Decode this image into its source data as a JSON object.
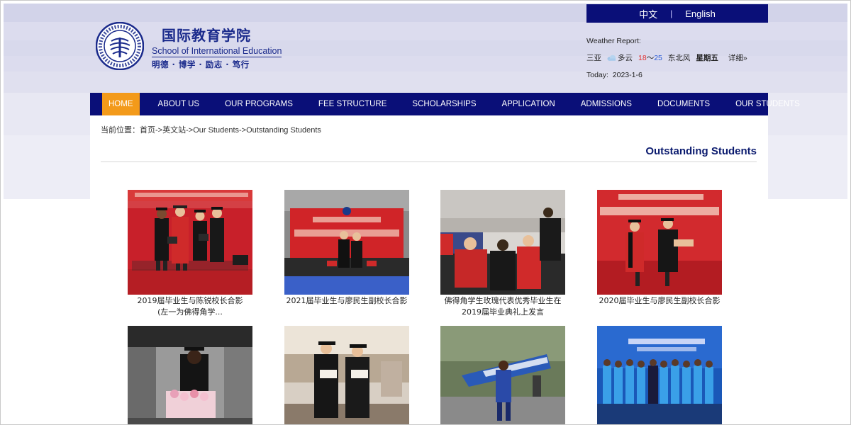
{
  "language": {
    "chinese": "中文",
    "separator": "|",
    "english": "English"
  },
  "logo": {
    "name_cn": "国际教育学院",
    "name_en": "School of International Education",
    "motto": "明德 · 博学 · 励志 · 笃行",
    "seal_icon": "university-seal-icon"
  },
  "weather": {
    "label": "Weather Report:",
    "city": "三亚",
    "condition": "多云",
    "temp_high": "18",
    "temp_sep": "～",
    "temp_low": "25",
    "wind": "东北风",
    "weekday": "星期五",
    "detail": "详细»",
    "today_label": "Today:",
    "today_date": "2023-1-6"
  },
  "nav": {
    "items": [
      {
        "label": "HOME"
      },
      {
        "label": "ABOUT US"
      },
      {
        "label": "OUR PROGRAMS"
      },
      {
        "label": "FEE STRUCTURE"
      },
      {
        "label": "SCHOLARSHIPS"
      },
      {
        "label": "APPLICATION"
      },
      {
        "label": "ADMISSIONS"
      },
      {
        "label": "DOCUMENTS"
      },
      {
        "label": "OUR STUDENTS"
      }
    ]
  },
  "breadcrumb": {
    "prefix": "当前位置：",
    "home": "首页",
    "sep1": "->",
    "english_site": "英文站",
    "sep2": "->",
    "section": "Our Students",
    "sep3": "->",
    "current": "Outstanding Students"
  },
  "page_title": "Outstanding Students",
  "cards": [
    {
      "caption_line1": "2019届毕业生与陈锐校长合影",
      "caption_line2": "(左一为佛得角学..."
    },
    {
      "caption_line1": "2021届毕业生与廖民生副校长合影",
      "caption_line2": ""
    },
    {
      "caption_line1": "佛得角学生玫瑰代表优秀毕业生在",
      "caption_line2": "2019届毕业典礼上发言"
    },
    {
      "caption_line1": "2020届毕业生与廖民生副校长合影",
      "caption_line2": ""
    },
    {
      "caption_line1": "",
      "caption_line2": ""
    },
    {
      "caption_line1": "",
      "caption_line2": ""
    },
    {
      "caption_line1": "",
      "caption_line2": ""
    },
    {
      "caption_line1": "",
      "caption_line2": ""
    }
  ],
  "colors": {
    "nav_bg": "#0a0f78",
    "nav_active": "#f39a1a",
    "title": "#0a1a6e",
    "brand_text": "#1b2b8c"
  }
}
